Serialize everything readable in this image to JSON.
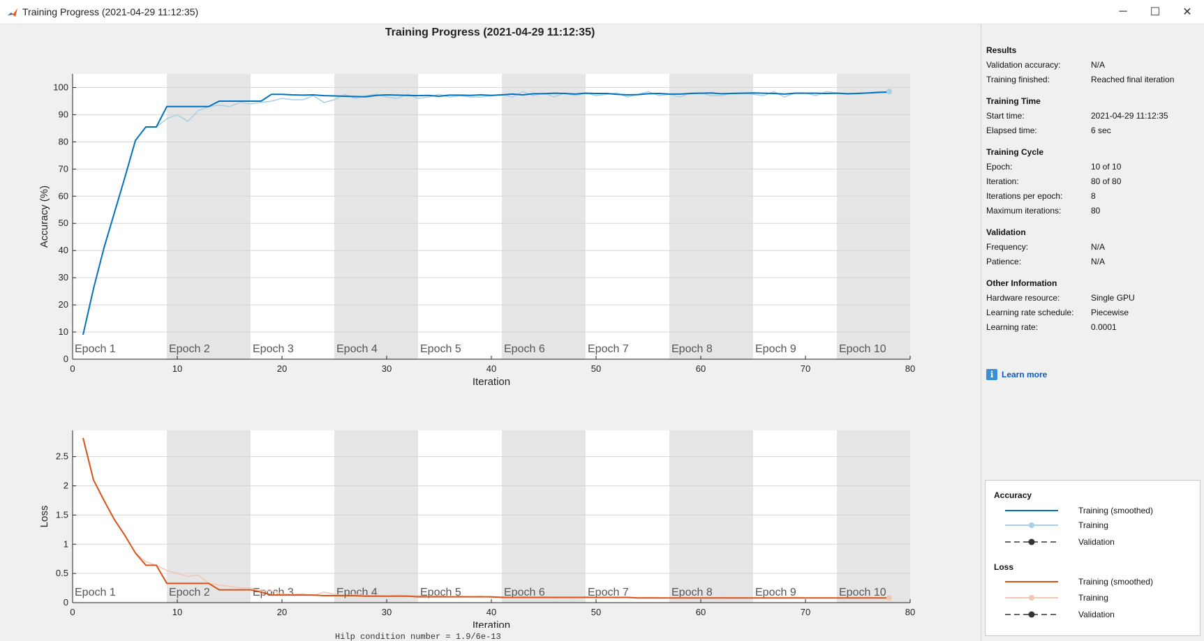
{
  "window": {
    "title": "Training Progress (2021-04-29 11:12:35)",
    "min_icon": "minimize-icon",
    "max_icon": "maximize-icon",
    "close_icon": "close-icon",
    "min_glyph": "─",
    "max_glyph": "☐",
    "close_glyph": "✕"
  },
  "main_title": "Training Progress (2021-04-29 11:12:35)",
  "colors": {
    "accuracy": "#0072bd",
    "accuracy_raw": "#a9cfe6",
    "loss": "#d95319",
    "loss_raw": "#f2c6b2",
    "epoch_shade": "#e5e5e5",
    "plot_bg": "#ffffff"
  },
  "chart_data": [
    {
      "type": "line",
      "ylabel": "Accuracy (%)",
      "xlabel": "Iteration",
      "xlim": [
        0,
        80
      ],
      "ylim": [
        0,
        105
      ],
      "x_ticks": [
        0,
        10,
        20,
        30,
        40,
        50,
        60,
        70,
        80
      ],
      "y_ticks": [
        0,
        10,
        20,
        30,
        40,
        50,
        60,
        70,
        80,
        90,
        100
      ],
      "epoch_labels": [
        "Epoch 1",
        "Epoch 2",
        "Epoch 3",
        "Epoch 4",
        "Epoch 5",
        "Epoch 6",
        "Epoch 7",
        "Epoch 8",
        "Epoch 9",
        "Epoch 10"
      ],
      "epoch_boundaries": [
        0,
        9,
        17,
        25,
        33,
        41,
        49,
        57,
        65,
        73,
        81
      ],
      "series": [
        {
          "name": "Training (smoothed)",
          "x": [
            1,
            2,
            3,
            4,
            5,
            6,
            7,
            8,
            9,
            10,
            11,
            12,
            13,
            14,
            15,
            16,
            17,
            18,
            19,
            20,
            21,
            22,
            23,
            24,
            25,
            26,
            27,
            28,
            29,
            30,
            31,
            32,
            33,
            34,
            35,
            36,
            37,
            38,
            39,
            40,
            41,
            42,
            43,
            44,
            45,
            46,
            47,
            48,
            49,
            50,
            51,
            52,
            53,
            54,
            55,
            56,
            57,
            58,
            59,
            60,
            61,
            62,
            63,
            64,
            65,
            66,
            67,
            68,
            69,
            70,
            71,
            72,
            73,
            74,
            75,
            76,
            77,
            78
          ],
          "values": [
            9,
            26,
            41,
            54,
            67,
            80.5,
            85.5,
            85.5,
            93,
            93,
            93,
            93,
            93,
            95,
            95,
            95,
            95,
            95,
            97.5,
            97.5,
            97.3,
            97.2,
            97.3,
            97,
            96.9,
            96.8,
            96.7,
            96.6,
            97.1,
            97.3,
            97.2,
            97.1,
            97,
            97.1,
            96.8,
            97.2,
            97.2,
            97.1,
            97.3,
            97.1,
            97.3,
            97.6,
            97.3,
            97.7,
            97.7,
            97.9,
            97.8,
            97.6,
            97.9,
            97.8,
            97.8,
            97.5,
            97.3,
            97.4,
            97.7,
            97.8,
            97.6,
            97.6,
            97.8,
            97.9,
            98,
            97.7,
            97.8,
            97.9,
            98,
            97.9,
            97.8,
            97.6,
            97.9,
            97.9,
            97.9,
            97.8,
            97.9,
            97.7,
            97.8,
            98,
            98.2,
            98.3
          ]
        },
        {
          "name": "Training",
          "x": [
            1,
            2,
            3,
            4,
            5,
            6,
            7,
            8,
            9,
            10,
            11,
            12,
            13,
            14,
            15,
            16,
            17,
            18,
            19,
            20,
            21,
            22,
            23,
            24,
            25,
            26,
            27,
            28,
            29,
            30,
            31,
            32,
            33,
            34,
            35,
            36,
            37,
            38,
            39,
            40,
            41,
            42,
            43,
            44,
            45,
            46,
            47,
            48,
            49,
            50,
            51,
            52,
            53,
            54,
            55,
            56,
            57,
            58,
            59,
            60,
            61,
            62,
            63,
            64,
            65,
            66,
            67,
            68,
            69,
            70,
            71,
            72,
            73,
            74,
            75,
            76,
            77,
            78
          ],
          "values": [
            9,
            26,
            41,
            54,
            67,
            80.5,
            85.5,
            85.5,
            88.5,
            90,
            87.5,
            91.5,
            93,
            93.5,
            93,
            94.5,
            94,
            94.5,
            95,
            96,
            95.5,
            95.5,
            97,
            94.5,
            95.5,
            97.5,
            96,
            97,
            97.5,
            96.5,
            96,
            97.5,
            96,
            96.5,
            97.5,
            96.5,
            97,
            96.5,
            96.5,
            97,
            97.5,
            96.5,
            98.5,
            97,
            98,
            96.5,
            98,
            97,
            98,
            97,
            97.5,
            98,
            96.5,
            97.5,
            98.5,
            97,
            97.5,
            96.5,
            98,
            98,
            97,
            97,
            98,
            98,
            97.5,
            97,
            98.5,
            96.5,
            98,
            98,
            97,
            98.5,
            98,
            97.5,
            98,
            98,
            98.5,
            98.5
          ]
        }
      ]
    },
    {
      "type": "line",
      "ylabel": "Loss",
      "xlabel": "Iteration",
      "xlim": [
        0,
        80
      ],
      "ylim": [
        0,
        2.95
      ],
      "x_ticks": [
        0,
        10,
        20,
        30,
        40,
        50,
        60,
        70,
        80
      ],
      "y_ticks": [
        0,
        0.5,
        1,
        1.5,
        2,
        2.5
      ],
      "epoch_labels": [
        "Epoch 1",
        "Epoch 2",
        "Epoch 3",
        "Epoch 4",
        "Epoch 5",
        "Epoch 6",
        "Epoch 7",
        "Epoch 8",
        "Epoch 9",
        "Epoch 10"
      ],
      "epoch_boundaries": [
        0,
        9,
        17,
        25,
        33,
        41,
        49,
        57,
        65,
        73,
        81
      ],
      "series": [
        {
          "name": "Training (smoothed)",
          "x": [
            1,
            2,
            3,
            4,
            5,
            6,
            7,
            8,
            9,
            10,
            11,
            12,
            13,
            14,
            15,
            16,
            17,
            18,
            19,
            20,
            21,
            22,
            23,
            24,
            25,
            26,
            27,
            28,
            29,
            30,
            31,
            32,
            33,
            34,
            35,
            36,
            37,
            38,
            39,
            40,
            41,
            42,
            43,
            44,
            45,
            46,
            47,
            48,
            49,
            50,
            51,
            52,
            53,
            54,
            55,
            56,
            57,
            58,
            59,
            60,
            61,
            62,
            63,
            64,
            65,
            66,
            67,
            68,
            69,
            70,
            71,
            72,
            73,
            74,
            75,
            76,
            77,
            78
          ],
          "values": [
            2.82,
            2.1,
            1.75,
            1.42,
            1.15,
            0.85,
            0.64,
            0.64,
            0.33,
            0.33,
            0.33,
            0.33,
            0.33,
            0.22,
            0.22,
            0.22,
            0.22,
            0.18,
            0.13,
            0.13,
            0.13,
            0.13,
            0.13,
            0.12,
            0.12,
            0.12,
            0.12,
            0.11,
            0.11,
            0.11,
            0.11,
            0.11,
            0.1,
            0.1,
            0.1,
            0.1,
            0.1,
            0.1,
            0.1,
            0.1,
            0.09,
            0.09,
            0.09,
            0.09,
            0.09,
            0.09,
            0.09,
            0.09,
            0.09,
            0.09,
            0.09,
            0.09,
            0.09,
            0.08,
            0.08,
            0.08,
            0.08,
            0.08,
            0.08,
            0.08,
            0.08,
            0.08,
            0.08,
            0.08,
            0.08,
            0.08,
            0.08,
            0.08,
            0.08,
            0.08,
            0.08,
            0.08,
            0.08,
            0.08,
            0.08,
            0.08,
            0.08,
            0.08
          ]
        },
        {
          "name": "Training",
          "x": [
            1,
            2,
            3,
            4,
            5,
            6,
            7,
            8,
            9,
            10,
            11,
            12,
            13,
            14,
            15,
            16,
            17,
            18,
            19,
            20,
            21,
            22,
            23,
            24,
            25,
            26,
            27,
            28,
            29,
            30,
            31,
            32,
            33,
            34,
            35,
            36,
            37,
            38,
            39,
            40,
            41,
            42,
            43,
            44,
            45,
            46,
            47,
            48,
            49,
            50,
            51,
            52,
            53,
            54,
            55,
            56,
            57,
            58,
            59,
            60,
            61,
            62,
            63,
            64,
            65,
            66,
            67,
            68,
            69,
            70,
            71,
            72,
            73,
            74,
            75,
            76,
            77,
            78
          ],
          "values": [
            2.82,
            2.1,
            1.75,
            1.42,
            1.15,
            0.85,
            0.7,
            0.64,
            0.55,
            0.5,
            0.45,
            0.47,
            0.33,
            0.3,
            0.28,
            0.25,
            0.25,
            0.2,
            0.2,
            0.15,
            0.14,
            0.15,
            0.12,
            0.18,
            0.14,
            0.12,
            0.14,
            0.12,
            0.13,
            0.11,
            0.13,
            0.12,
            0.12,
            0.1,
            0.12,
            0.1,
            0.11,
            0.1,
            0.11,
            0.09,
            0.1,
            0.09,
            0.1,
            0.09,
            0.1,
            0.08,
            0.09,
            0.08,
            0.1,
            0.08,
            0.09,
            0.08,
            0.09,
            0.08,
            0.09,
            0.08,
            0.08,
            0.09,
            0.08,
            0.08,
            0.08,
            0.09,
            0.08,
            0.08,
            0.08,
            0.08,
            0.08,
            0.08,
            0.09,
            0.08,
            0.08,
            0.08,
            0.08,
            0.08,
            0.08,
            0.09,
            0.08,
            0.08
          ]
        }
      ]
    }
  ],
  "sidebar": {
    "results": {
      "title": "Results",
      "rows": [
        {
          "label": "Validation accuracy:",
          "value": "N/A"
        },
        {
          "label": "Training finished:",
          "value": "Reached final iteration"
        }
      ]
    },
    "training_time": {
      "title": "Training Time",
      "rows": [
        {
          "label": "Start time:",
          "value": "2021-04-29 11:12:35"
        },
        {
          "label": "Elapsed time:",
          "value": "6 sec"
        }
      ]
    },
    "training_cycle": {
      "title": "Training Cycle",
      "rows": [
        {
          "label": "Epoch:",
          "value": "10 of 10"
        },
        {
          "label": "Iteration:",
          "value": "80 of 80"
        },
        {
          "label": "Iterations per epoch:",
          "value": "8"
        },
        {
          "label": "Maximum iterations:",
          "value": "80"
        }
      ]
    },
    "validation": {
      "title": "Validation",
      "rows": [
        {
          "label": "Frequency:",
          "value": "N/A"
        },
        {
          "label": "Patience:",
          "value": "N/A"
        }
      ]
    },
    "other": {
      "title": "Other Information",
      "rows": [
        {
          "label": "Hardware resource:",
          "value": "Single GPU"
        },
        {
          "label": "Learning rate schedule:",
          "value": "Piecewise"
        },
        {
          "label": "Learning rate:",
          "value": "0.0001"
        }
      ]
    },
    "learn_more": "Learn more",
    "learn_more_icon": "info-icon",
    "info_glyph": "i"
  },
  "legend": {
    "accuracy_title": "Accuracy",
    "loss_title": "Loss",
    "training_smoothed": "Training (smoothed)",
    "training": "Training",
    "validation": "Validation"
  },
  "bottom_snippet": "Hilp condition number = 1.9/6e-13"
}
